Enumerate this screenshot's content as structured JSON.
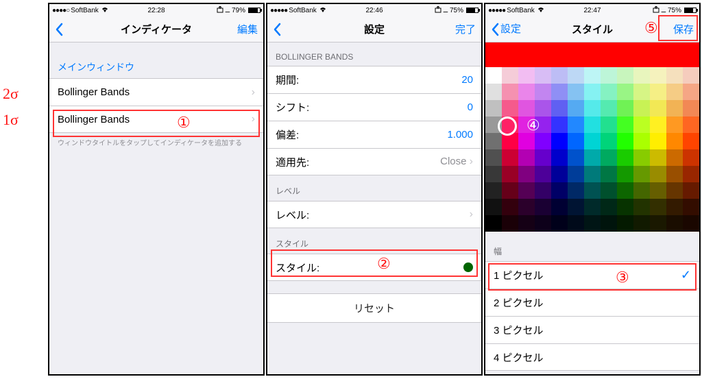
{
  "sigma_labels": {
    "a": "2σ",
    "b": "1σ"
  },
  "annotations": {
    "n1": "①",
    "n2": "②",
    "n3": "③",
    "n4": "④",
    "n5": "⑤"
  },
  "phone1": {
    "status": {
      "carrier": "SoftBank",
      "time": "22:28",
      "battery_pct": "79%",
      "battery_fill": "79%"
    },
    "nav": {
      "title": "インディケータ",
      "action": "編集"
    },
    "section": "メインウィンドウ",
    "rows": [
      {
        "label": "Bollinger Bands"
      },
      {
        "label": "Bollinger Bands"
      }
    ],
    "footnote": "ウィンドウタイトルをタップしてインディケータを追加する"
  },
  "phone2": {
    "status": {
      "carrier": "SoftBank",
      "time": "22:46",
      "battery_pct": "75%",
      "battery_fill": "75%"
    },
    "nav": {
      "title": "設定",
      "action": "完了"
    },
    "sec_bb": "BOLLINGER BANDS",
    "rows_bb": [
      {
        "label": "期間:",
        "value": "20"
      },
      {
        "label": "シフト:",
        "value": "0"
      },
      {
        "label": "偏差:",
        "value": "1.000"
      },
      {
        "label": "適用先:",
        "value": "Close",
        "gray": true,
        "chev": true
      }
    ],
    "sec_level": "レベル",
    "row_level": {
      "label": "レベル:",
      "chev": true
    },
    "sec_style": "スタイル",
    "row_style": {
      "label": "スタイル:"
    },
    "reset": "リセット"
  },
  "phone3": {
    "status": {
      "carrier": "SoftBank",
      "time": "22:47",
      "battery_pct": "75%",
      "battery_fill": "75%"
    },
    "nav": {
      "back": "設定",
      "title": "スタイル",
      "action": "保存"
    },
    "selected_color": "#ff0000",
    "sec_width": "幅",
    "width_rows": [
      {
        "label": "1 ピクセル",
        "checked": true
      },
      {
        "label": "2 ピクセル"
      },
      {
        "label": "3 ピクセル"
      },
      {
        "label": "4 ピクセル"
      }
    ],
    "palette": [
      [
        "#ffffff",
        "#f5ccd8",
        "#f2bdf2",
        "#d8bdf5",
        "#bdbdf5",
        "#bdd8f5",
        "#bdf5f5",
        "#bdf5d8",
        "#c8f5bd",
        "#e8f5bd",
        "#f5f2bd",
        "#f5e0bd",
        "#f5ccbd"
      ],
      [
        "#e0e0e0",
        "#f591b0",
        "#ea85ea",
        "#c285f0",
        "#8f8ff5",
        "#85c2f2",
        "#85f2f2",
        "#85f2c2",
        "#99f585",
        "#d6f585",
        "#f5ef85",
        "#f5cc85",
        "#f5a685"
      ],
      [
        "#c0c0c0",
        "#f55a8c",
        "#e055e0",
        "#aa55ea",
        "#6060f2",
        "#55aaf2",
        "#55eaea",
        "#55eab0",
        "#70f255",
        "#c8f255",
        "#f2e855",
        "#f2b355",
        "#f28855"
      ],
      [
        "#999999",
        "#ff2266",
        "#e022e0",
        "#9522ee",
        "#3333ff",
        "#2288ff",
        "#22e0e0",
        "#22e08f",
        "#44ff22",
        "#bbff22",
        "#fff022",
        "#ff9922",
        "#ff6622"
      ],
      [
        "#707070",
        "#ff0044",
        "#e000e0",
        "#8000ff",
        "#0000ff",
        "#0066ff",
        "#00d4d4",
        "#00d47a",
        "#22ff00",
        "#aaff00",
        "#ffee00",
        "#ff8800",
        "#ff4400"
      ],
      [
        "#505050",
        "#cc0033",
        "#b300b3",
        "#6600cc",
        "#0000cc",
        "#0052cc",
        "#00aaaa",
        "#00aa60",
        "#1acc00",
        "#88cc00",
        "#ccbb00",
        "#cc6a00",
        "#cc3300"
      ],
      [
        "#383838",
        "#990026",
        "#800080",
        "#4d0099",
        "#000099",
        "#003d99",
        "#007a7a",
        "#007744",
        "#149900",
        "#669900",
        "#998c00",
        "#994f00",
        "#992600"
      ],
      [
        "#222222",
        "#660019",
        "#550055",
        "#330066",
        "#000066",
        "#002966",
        "#005252",
        "#00502d",
        "#0d6600",
        "#446600",
        "#665e00",
        "#663500",
        "#661a00"
      ],
      [
        "#111111",
        "#33000d",
        "#2b002b",
        "#1a0033",
        "#000033",
        "#001433",
        "#002a2a",
        "#002817",
        "#073300",
        "#223300",
        "#332f00",
        "#331a00",
        "#330d00"
      ],
      [
        "#000000",
        "#1a0007",
        "#150015",
        "#0d001a",
        "#00001a",
        "#000a1a",
        "#001515",
        "#00140c",
        "#041a00",
        "#111a00",
        "#1a1800",
        "#1a0d00",
        "#1a0700"
      ]
    ]
  }
}
